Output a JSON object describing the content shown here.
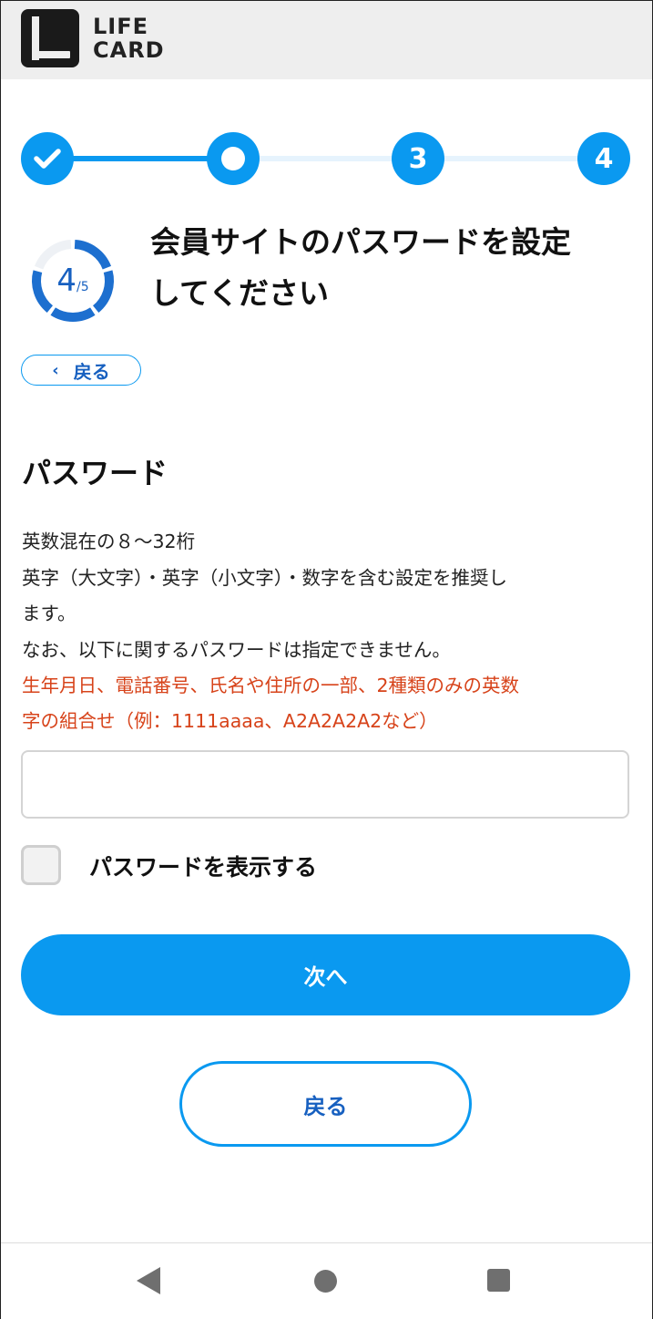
{
  "header": {
    "logo_line1": "LIFE",
    "logo_line2": "CARD"
  },
  "stepper": {
    "steps": [
      {
        "label": "",
        "state": "completed",
        "icon": "check-icon"
      },
      {
        "label": "",
        "state": "current"
      },
      {
        "label": "3",
        "state": "upcoming"
      },
      {
        "label": "4",
        "state": "upcoming"
      }
    ],
    "accent_color": "#0a99f0"
  },
  "progress": {
    "current": "4",
    "total": "/5",
    "value": 0.8
  },
  "page": {
    "title_line1": "会員サイトのパスワードを設定",
    "title_line2": "してください",
    "back_link_label": "戻る"
  },
  "password_section": {
    "heading": "パスワード",
    "help_line1": "英数混在の８〜32桁",
    "help_line2": "英字（大文字）・英字（小文字）・数字を含む設定を推奨し",
    "help_line3": "ます。",
    "help_line4": "なお、以下に関するパスワードは指定できません。",
    "warning_line1": "生年月日、電話番号、氏名や住所の一部、2種類のみの英数",
    "warning_line2": "字の組合せ（例：1111aaaa、A2A2A2A2など）",
    "input_value": "",
    "show_password_label": "パスワードを表示する",
    "show_password_checked": false
  },
  "actions": {
    "next_label": "次へ",
    "back_label": "戻る"
  },
  "android_nav": {
    "back": "back-triangle-icon",
    "home": "home-circle-icon",
    "recents": "recents-square-icon"
  }
}
